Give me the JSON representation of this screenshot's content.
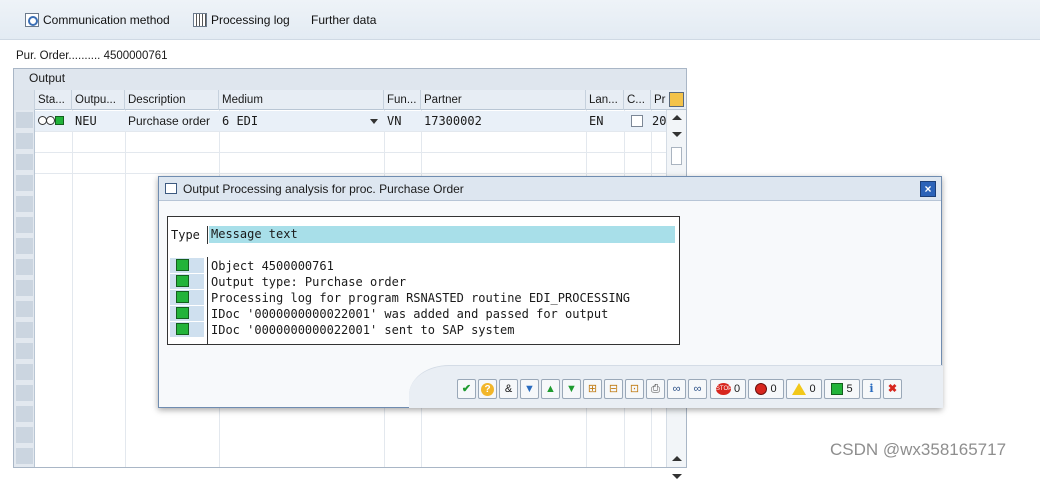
{
  "toolbar": {
    "communication_method": "Communication method",
    "processing_log": "Processing log",
    "further_data": "Further data"
  },
  "header": {
    "pur_order_label": "Pur. Order..........",
    "pur_order_number": "4500000761"
  },
  "output_panel": {
    "title": "Output",
    "columns": [
      "Sta...",
      "Outpu...",
      "Description",
      "Medium",
      "Fun...",
      "Partner",
      "Lan...",
      "C...",
      "Pr"
    ],
    "row": {
      "output_type": "NEU",
      "description": "Purchase order",
      "medium": "6 EDI",
      "function": "VN",
      "partner": "17300002",
      "language": "EN",
      "priority": "20"
    }
  },
  "dialog": {
    "title": "Output Processing analysis for proc. Purchase Order",
    "type_header": "Type",
    "text_header": "Message text",
    "messages": [
      "Object 4500000761",
      "Output type: Purchase order",
      "Processing log for program RSNASTED routine EDI_PROCESSING",
      "IDoc '0000000000022001' was added and passed for output",
      "IDoc '0000000000022001' sent to SAP system"
    ],
    "counts": {
      "stop": "0",
      "error": "0",
      "warning": "0",
      "success": "5"
    },
    "colors": {
      "success": "#22b33a",
      "error": "#d7261e",
      "warning": "#f2c81a"
    }
  },
  "watermark": "CSDN @wx358165717"
}
